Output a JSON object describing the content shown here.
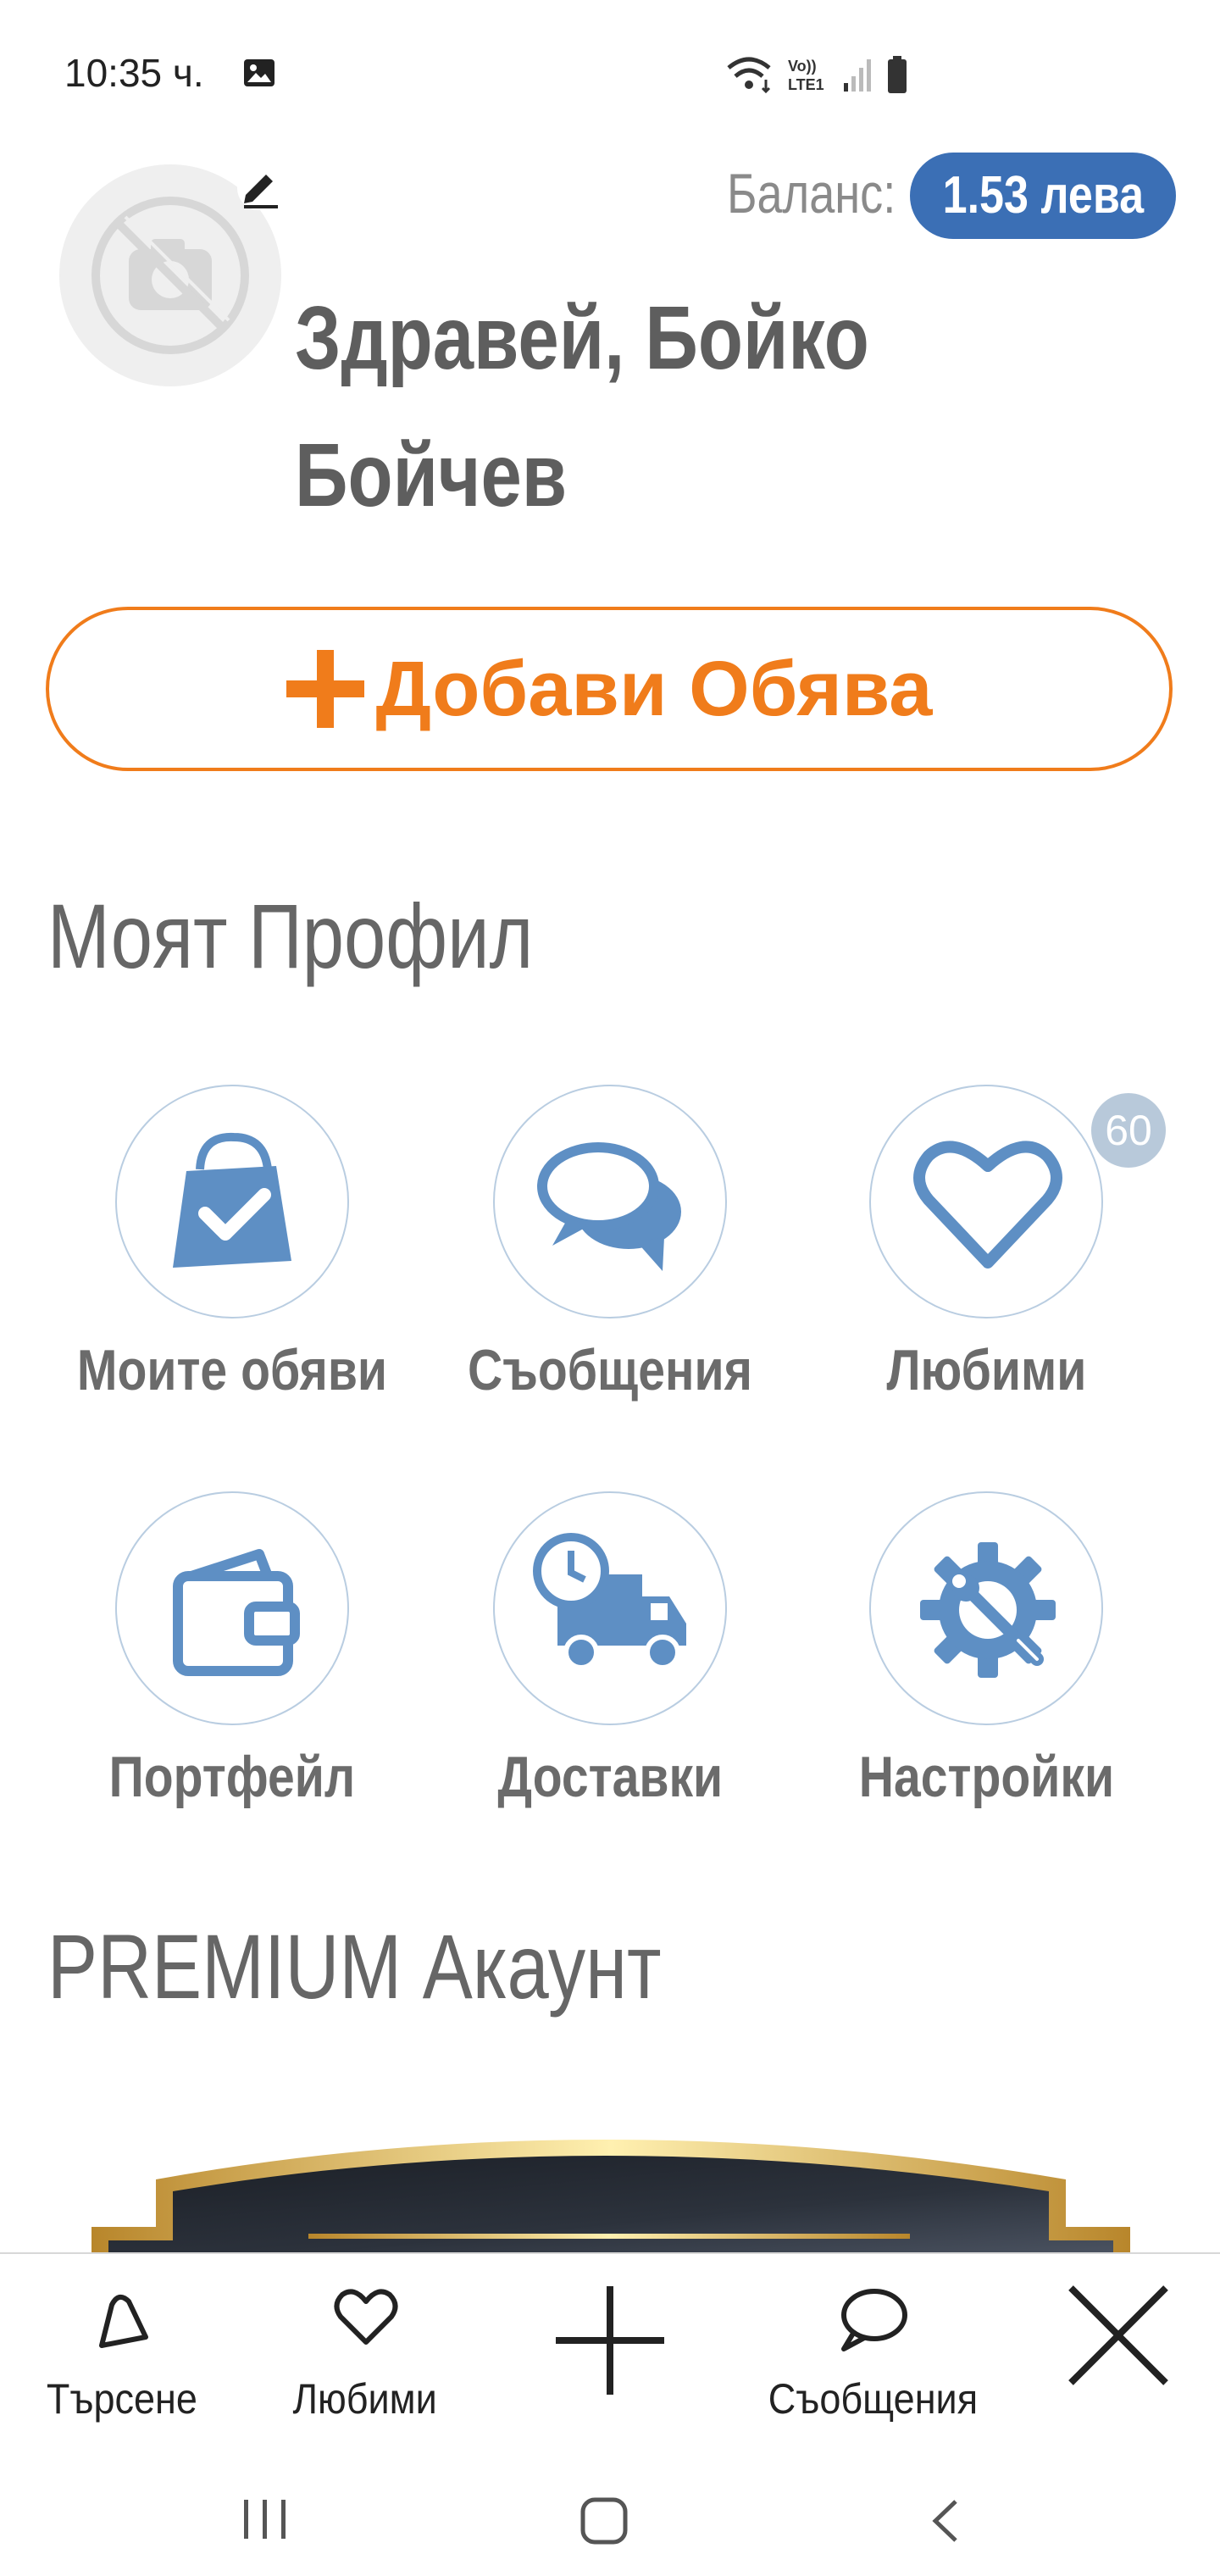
{
  "status_bar": {
    "time": "10:35 ч.",
    "network": "LTE1"
  },
  "header": {
    "balance_label": "Баланс:",
    "balance_value": "1.53 лева",
    "greeting": "Здравей, Бойко",
    "greeting_line2": "Бойчев"
  },
  "add_listing": {
    "label": "Добави Обява"
  },
  "profile": {
    "title": "Моят Профил",
    "items": [
      {
        "label": "Моите обяви",
        "icon": "shopping-bag-check-icon"
      },
      {
        "label": "Съобщения",
        "icon": "chat-bubbles-icon"
      },
      {
        "label": "Любими",
        "icon": "heart-icon",
        "badge": "60"
      },
      {
        "label": "Портфейл",
        "icon": "wallet-icon"
      },
      {
        "label": "Доставки",
        "icon": "delivery-truck-icon"
      },
      {
        "label": "Настройки",
        "icon": "settings-gear-icon"
      }
    ]
  },
  "premium": {
    "title": "PREMIUM Акаунт"
  },
  "bottom_nav": {
    "search": "Търсене",
    "favorites": "Любими",
    "add": "",
    "messages": "Съобщения",
    "close": ""
  },
  "colors": {
    "accent_orange": "#f07c1b",
    "accent_blue": "#3b6fb5",
    "icon_blue": "#5e8fc4"
  }
}
